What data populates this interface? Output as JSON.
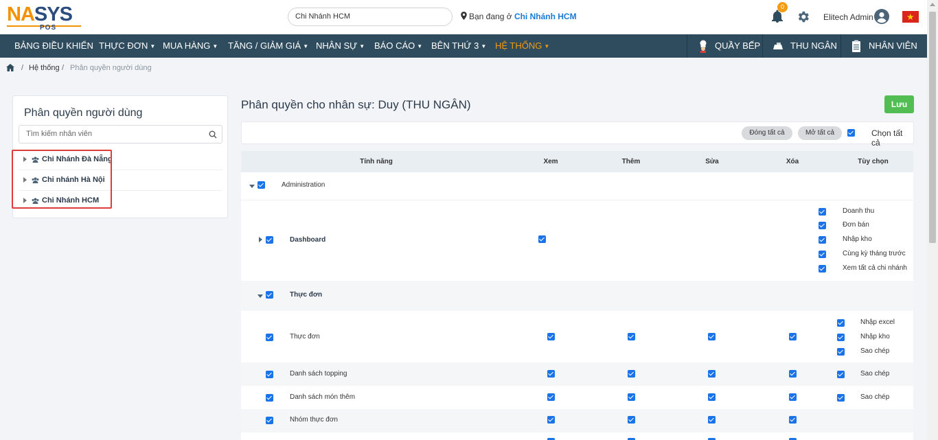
{
  "header": {
    "logo_na": "NA",
    "logo_sys": "SYS",
    "logo_pos": "POS",
    "branch_value": "Chi Nhánh HCM",
    "location_prefix": "Bạn đang ở",
    "location_branch": "Chi Nhánh HCM",
    "notification_count": "0",
    "user_name": "Elitech Admin",
    "flag": "vietnam-flag"
  },
  "nav": {
    "items": [
      "BẢNG ĐIỀU KHIỂN",
      "THỰC ĐƠN",
      "MUA HÀNG",
      "TĂNG / GIẢM GIÁ",
      "NHÂN SỰ",
      "BÁO CÁO",
      "BÊN THỨ 3",
      "HỆ THỐNG"
    ],
    "active": "HỆ THỐNG",
    "right": [
      "QUẦY BẾP",
      "THU NGÂN",
      "NHÂN VIÊN"
    ]
  },
  "breadcrumb": {
    "separator": "/",
    "parent": "Hệ thống",
    "current": "Phân quyền người dùng"
  },
  "left_panel": {
    "title": "Phân quyền người dùng",
    "search_placeholder": "Tìm kiếm nhân viên",
    "branches": [
      "Chi Nhánh Đà Nẵng",
      "Chi nhánh Hà Nội",
      "Chi Nhánh HCM"
    ]
  },
  "main": {
    "title": "Phân quyền cho nhân sự: Duy (THU NGÂN)",
    "save_label": "Lưu",
    "collapse_all": "Đóng tất cả",
    "expand_all": "Mở tất cả",
    "select_all": "Chọn tất cả",
    "columns": [
      "Tính năng",
      "Xem",
      "Thêm",
      "Sửa",
      "Xóa",
      "Tùy chọn"
    ]
  },
  "permissions": {
    "group_administration": "Administration",
    "dashboard": {
      "label": "Dashboard",
      "options": [
        "Doanh thu",
        "Đơn bán",
        "Nhập kho",
        "Cùng kỳ tháng trước",
        "Xem tất cả chi nhánh"
      ]
    },
    "group_menu": "Thực đơn",
    "rows": [
      {
        "label": "Thực đơn",
        "options": [
          "Nhập excel",
          "Nhập kho",
          "Sao chép"
        ]
      },
      {
        "label": "Danh sách topping",
        "options": [
          "Sao chép"
        ]
      },
      {
        "label": "Danh sách món thêm",
        "options": [
          "Sao chép"
        ]
      },
      {
        "label": "Nhóm thực đơn",
        "options": []
      }
    ]
  },
  "colors": {
    "accent_orange": "#f39c12",
    "nav_bg": "#2f4b5e",
    "checkbox_blue": "#1a73e8",
    "save_green": "#52bd52",
    "highlight_red": "#e03b3b"
  }
}
